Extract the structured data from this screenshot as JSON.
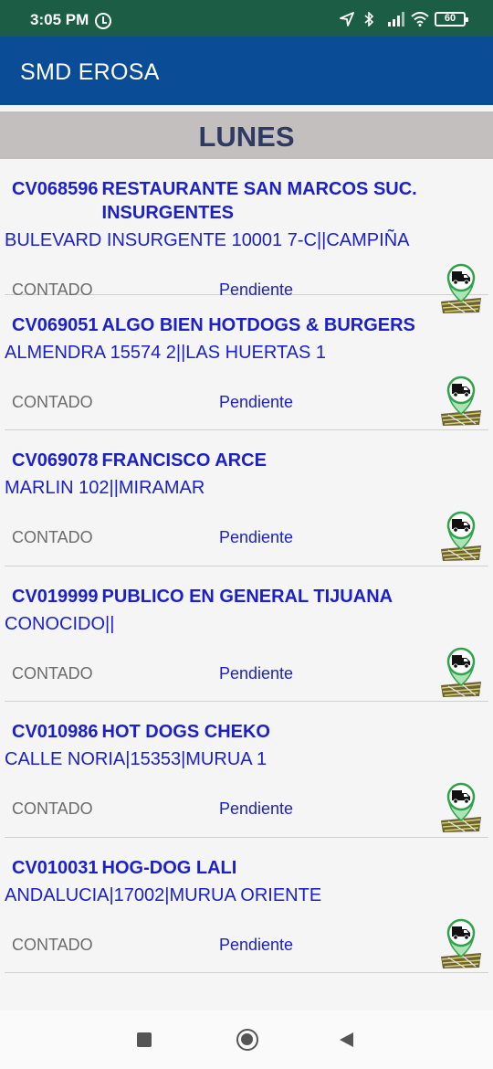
{
  "status_bar": {
    "time": "3:05 PM",
    "battery": "60",
    "icons": [
      "alarm-icon",
      "location-arrow-icon",
      "bluetooth-icon",
      "signal-icon",
      "wifi-icon",
      "battery-icon"
    ]
  },
  "app_bar": {
    "title": "SMD EROSA"
  },
  "day_header": {
    "title": "LUNES"
  },
  "customers": [
    {
      "code": "CV068596",
      "name": "RESTAURANTE SAN MARCOS SUC. INSURGENTES",
      "address": "BULEVARD INSURGENTE 10001 7-C||CAMPIÑA",
      "payment": "CONTADO",
      "status": "Pendiente"
    },
    {
      "code": "CV069051",
      "name": "ALGO BIEN HOTDOGS & BURGERS",
      "address": "ALMENDRA 15574 2||LAS HUERTAS 1",
      "payment": "CONTADO",
      "status": "Pendiente"
    },
    {
      "code": "CV069078",
      "name": "FRANCISCO ARCE",
      "address": "MARLIN 102||MIRAMAR",
      "payment": "CONTADO",
      "status": "Pendiente"
    },
    {
      "code": "CV019999",
      "name": "PUBLICO EN GENERAL TIJUANA",
      "address": "CONOCIDO||",
      "payment": "CONTADO",
      "status": "Pendiente"
    },
    {
      "code": "CV010986",
      "name": "HOT DOGS CHEKO",
      "address": "CALLE NORIA|15353|MURUA 1",
      "payment": "CONTADO",
      "status": "Pendiente"
    },
    {
      "code": "CV010031",
      "name": "HOG-DOG LALI",
      "address": "ANDALUCIA|17002|MURUA ORIENTE",
      "payment": "CONTADO",
      "status": "Pendiente"
    }
  ],
  "nav_bar": {
    "icons": [
      "recents-icon",
      "home-icon",
      "back-icon"
    ]
  },
  "colors": {
    "status_bar": "#1b5e45",
    "app_bar": "#0a4d96",
    "day_header_bg": "#c4bfbf",
    "day_header_text": "#2f3a63",
    "customer_text": "#1b21c6",
    "payment_text": "#6c6c6c",
    "route_icon_accent": "#2fa34a"
  }
}
